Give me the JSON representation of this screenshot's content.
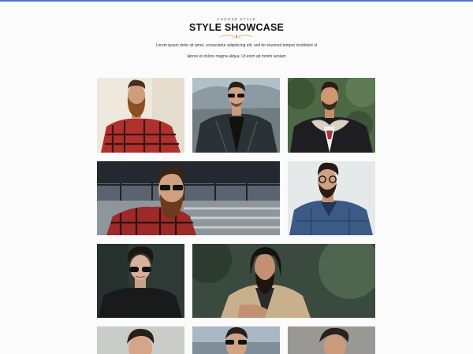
{
  "header": {
    "eyebrow": "CHOOSE STYLE",
    "title": "STYLE SHOWCASE",
    "description_line1": "Lorem ipsum dolor sit amet, consectetur adipisicing elit, sed do eiusmod tempor incididunt ut",
    "description_line2": "labore et dolore magna aliqua. Ut enim ad minim veniam"
  },
  "gallery": {
    "items": [
      {
        "name": "photo-bearded-man-red-plaid-shirt"
      },
      {
        "name": "photo-man-sunglasses-leather-jacket"
      },
      {
        "name": "photo-man-shearling-jacket-forest"
      },
      {
        "name": "photo-bearded-man-sunglasses-plaid-wide"
      },
      {
        "name": "photo-man-glasses-denim-jacket"
      },
      {
        "name": "photo-man-sunglasses-dark-portrait"
      },
      {
        "name": "photo-long-haired-man-beige-blazer-wide"
      },
      {
        "name": "photo-man-partial-left"
      },
      {
        "name": "photo-man-sunglasses-partial"
      },
      {
        "name": "photo-man-partial-right"
      }
    ]
  },
  "colors": {
    "accent_bar": "#4a6fd8",
    "ornament": "#c8a054"
  }
}
